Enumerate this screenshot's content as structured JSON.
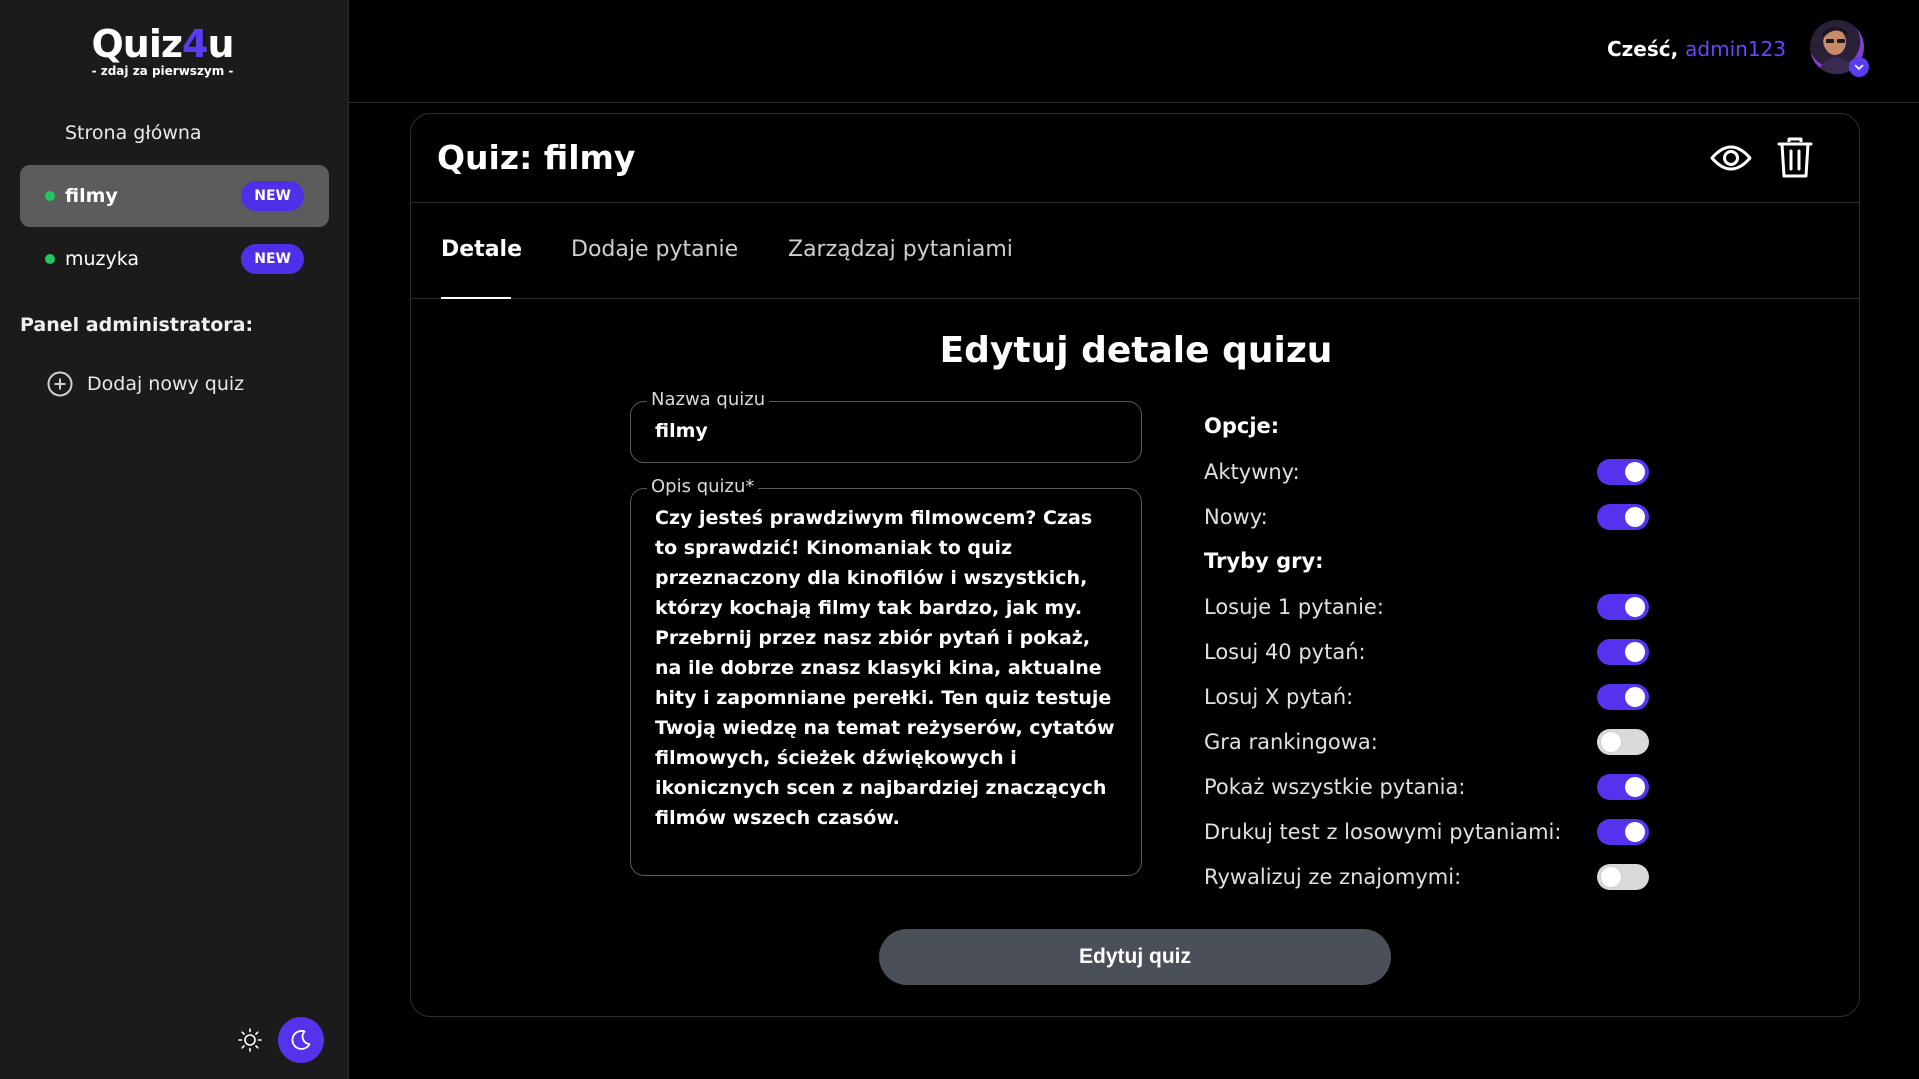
{
  "brand": {
    "name_main": "Quiz",
    "name_accent": "4",
    "name_tail": "u",
    "tagline": "- zdaj za pierwszym -"
  },
  "sidebar": {
    "home_label": "Strona główna",
    "items": [
      {
        "label": "filmy",
        "badge": "NEW",
        "active": true
      },
      {
        "label": "muzyka",
        "badge": "NEW",
        "active": false
      }
    ],
    "admin_heading": "Panel administratora:",
    "add_quiz_label": "Dodaj nowy quiz"
  },
  "header": {
    "greeting": "Cześć,",
    "username": "admin123"
  },
  "card": {
    "title": "Quiz: filmy",
    "tabs": [
      "Detale",
      "Dodaje pytanie",
      "Zarządzaj pytaniami"
    ],
    "form_title": "Edytuj detale quizu",
    "name_label": "Nazwa quizu",
    "name_value": "filmy",
    "desc_label": "Opis quizu*",
    "desc_value": "Czy jesteś prawdziwym filmowcem? Czas to sprawdzić! Kinomaniak to quiz przeznaczony dla kinofilów i wszystkich, którzy kochają filmy tak bardzo, jak my. Przebrnij przez nasz zbiór pytań i pokaż, na ile dobrze znasz klasyki kina, aktualne hity i zapomniane perełki. Ten quiz testuje Twoją wiedzę na temat reżyserów, cytatów filmowych, ścieżek dźwiękowych i ikonicznych scen z najbardziej znaczących filmów wszech czasów.",
    "options_heading": "Opcje:",
    "options": [
      {
        "label": "Aktywny:",
        "on": true
      },
      {
        "label": "Nowy:",
        "on": true
      }
    ],
    "modes_heading": "Tryby gry:",
    "modes": [
      {
        "label": "Losuje 1 pytanie:",
        "on": true
      },
      {
        "label": "Losuj 40 pytań:",
        "on": true
      },
      {
        "label": "Losuj X pytań:",
        "on": true
      },
      {
        "label": "Gra rankingowa:",
        "on": false
      },
      {
        "label": "Pokaż wszystkie pytania:",
        "on": true
      },
      {
        "label": "Drukuj test z losowymi pytaniami:",
        "on": true
      },
      {
        "label": "Rywalizuj ze znajomymi:",
        "on": false
      }
    ],
    "submit_label": "Edytuj quiz"
  },
  "colors": {
    "accent": "#5532ee",
    "active_dot": "#22c55e",
    "button": "#4b4f58"
  },
  "icons": [
    "plus-circle-icon",
    "sun-icon",
    "moon-icon",
    "eye-icon",
    "trash-icon",
    "check-icon"
  ]
}
